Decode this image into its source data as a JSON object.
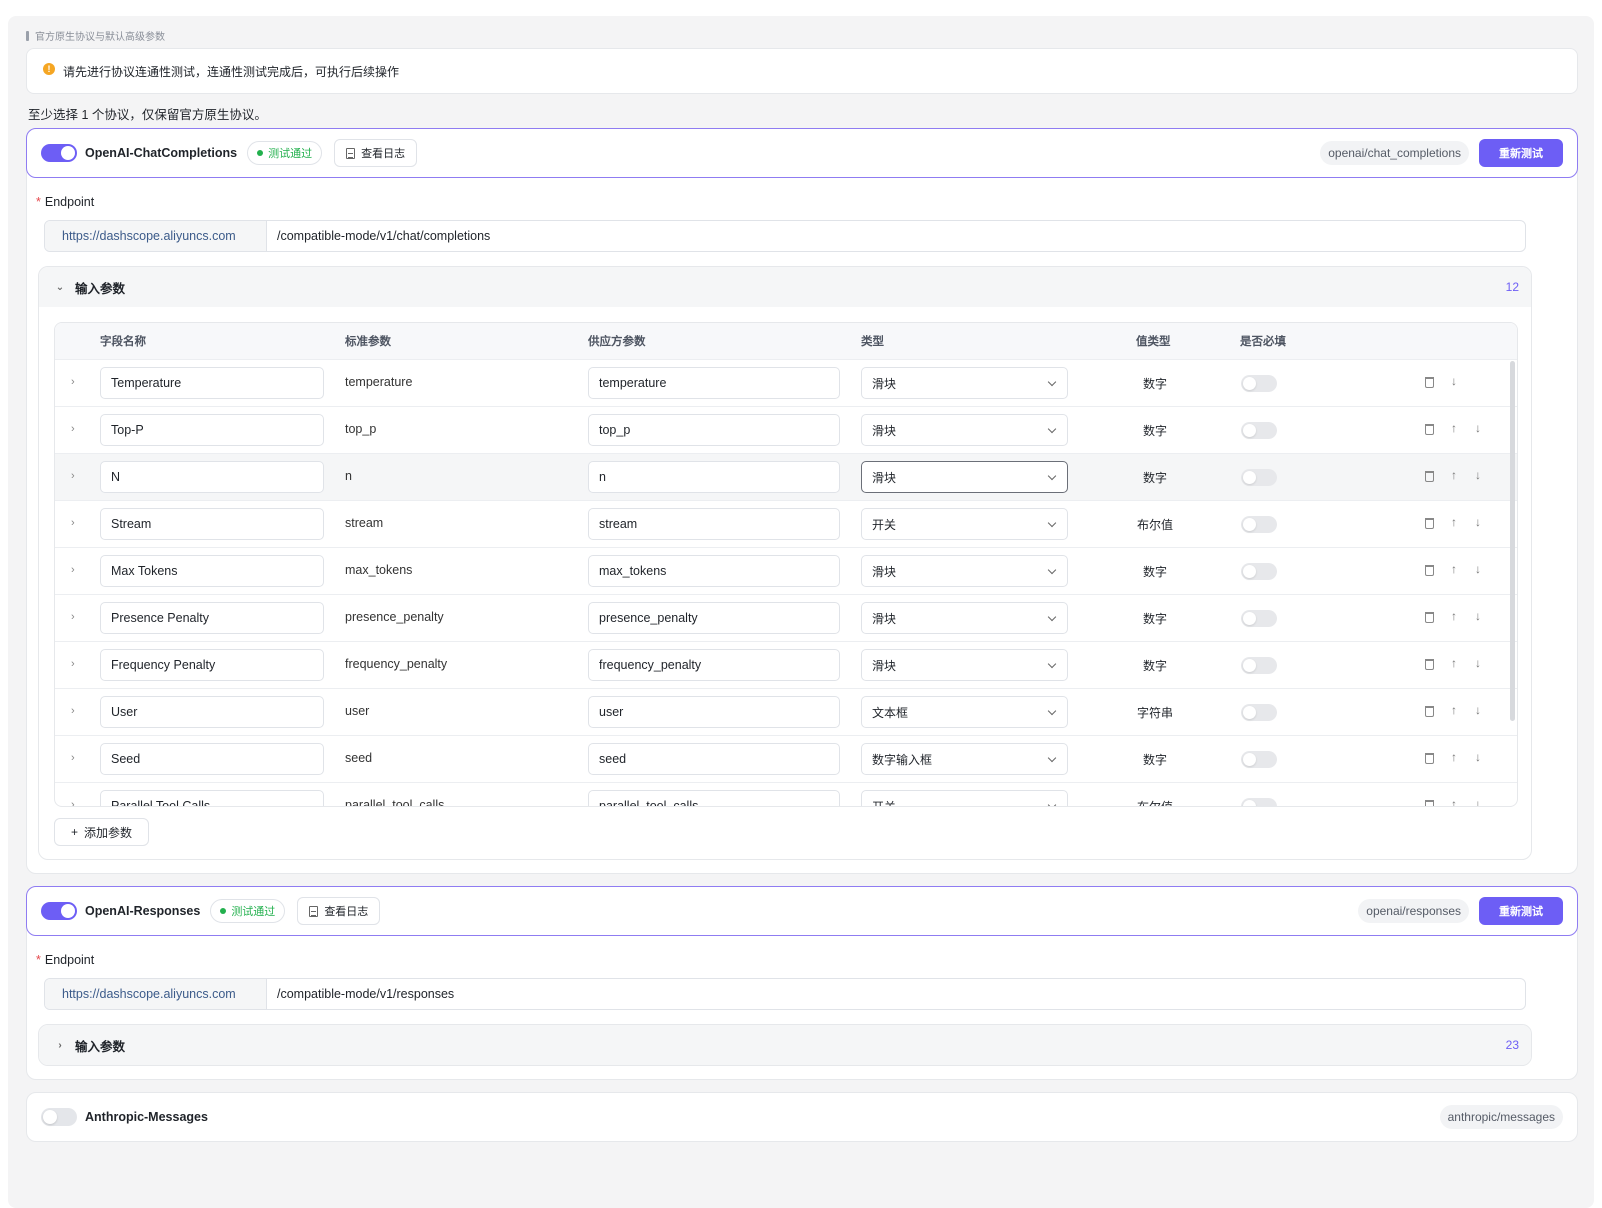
{
  "section_title": "官方原生协议与默认高级参数",
  "notice": "请先进行协议连通性测试，连通性测试完成后，可执行后续操作",
  "hint": "至少选择 1 个协议，仅保留官方原生协议。",
  "accent_color": "#6d5ef5",
  "protocols": [
    {
      "name": "OpenAI-ChatCompletions",
      "enabled": true,
      "status": "测试通过",
      "log_label": "查看日志",
      "path_tag": "openai/chat_completions",
      "retest_label": "重新测试",
      "endpoint_label": "Endpoint",
      "endpoint_base": "https://dashscope.aliyuncs.com",
      "endpoint_path": "/compatible-mode/v1/chat/completions",
      "params_title": "输入参数",
      "params_count": "12",
      "add_label": "添加参数"
    },
    {
      "name": "OpenAI-Responses",
      "enabled": true,
      "status": "测试通过",
      "log_label": "查看日志",
      "path_tag": "openai/responses",
      "retest_label": "重新测试",
      "endpoint_label": "Endpoint",
      "endpoint_base": "https://dashscope.aliyuncs.com",
      "endpoint_path": "/compatible-mode/v1/responses",
      "params_title": "输入参数",
      "params_count": "23"
    },
    {
      "name": "Anthropic-Messages",
      "enabled": false,
      "path_tag": "anthropic/messages"
    }
  ],
  "table": {
    "headers": [
      "字段名称",
      "标准参数",
      "供应方参数",
      "类型",
      "值类型",
      "是否必填"
    ],
    "rows": [
      {
        "name": "Temperature",
        "std": "temperature",
        "provider": "temperature",
        "type": "滑块",
        "value_type": "数字",
        "required": false
      },
      {
        "name": "Top-P",
        "std": "top_p",
        "provider": "top_p",
        "type": "滑块",
        "value_type": "数字",
        "required": false
      },
      {
        "name": "N",
        "std": "n",
        "provider": "n",
        "type": "滑块",
        "value_type": "数字",
        "required": false
      },
      {
        "name": "Stream",
        "std": "stream",
        "provider": "stream",
        "type": "开关",
        "value_type": "布尔值",
        "required": false
      },
      {
        "name": "Max Tokens",
        "std": "max_tokens",
        "provider": "max_tokens",
        "type": "滑块",
        "value_type": "数字",
        "required": false
      },
      {
        "name": "Presence Penalty",
        "std": "presence_penalty",
        "provider": "presence_penalty",
        "type": "滑块",
        "value_type": "数字",
        "required": false
      },
      {
        "name": "Frequency Penalty",
        "std": "frequency_penalty",
        "provider": "frequency_penalty",
        "type": "滑块",
        "value_type": "数字",
        "required": false
      },
      {
        "name": "User",
        "std": "user",
        "provider": "user",
        "type": "文本框",
        "value_type": "字符串",
        "required": false
      },
      {
        "name": "Seed",
        "std": "seed",
        "provider": "seed",
        "type": "数字输入框",
        "value_type": "数字",
        "required": false
      },
      {
        "name": "Parallel Tool Calls",
        "std": "parallel_tool_calls",
        "provider": "parallel_tool_calls",
        "type": "开关",
        "value_type": "布尔值",
        "required": false
      }
    ]
  }
}
